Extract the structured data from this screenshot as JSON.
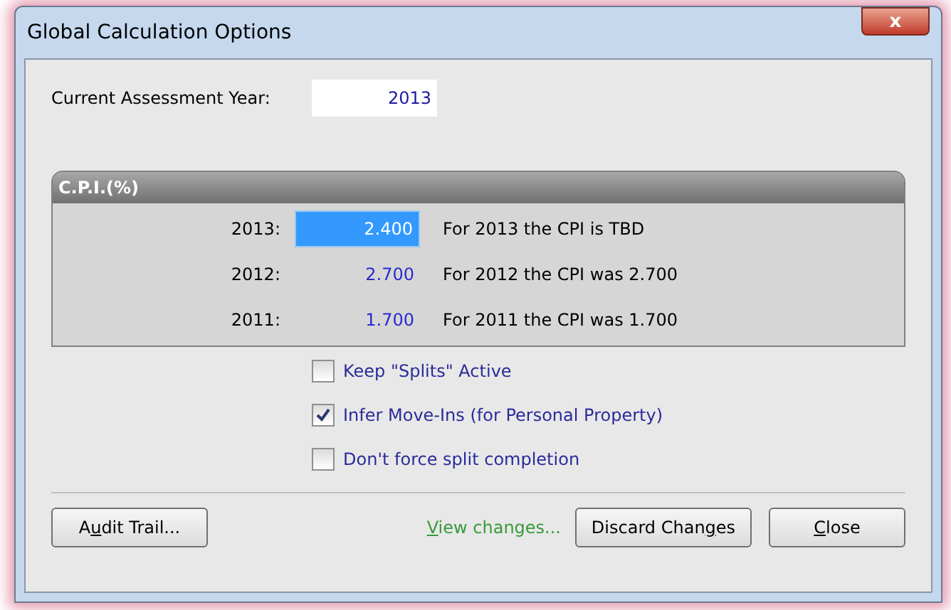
{
  "window": {
    "title": "Global Calculation Options",
    "close_label": "x"
  },
  "assessment_year": {
    "label": "Current Assessment Year:",
    "value": "2013"
  },
  "cpi": {
    "title": "C.P.I.(%)",
    "rows": [
      {
        "year": "2013:",
        "value": "2.400",
        "selected": true,
        "note": "For 2013 the CPI is TBD"
      },
      {
        "year": "2012:",
        "value": "2.700",
        "selected": false,
        "note": "For 2012 the CPI was 2.700"
      },
      {
        "year": "2011:",
        "value": "1.700",
        "selected": false,
        "note": "For 2011 the CPI was 1.700"
      }
    ]
  },
  "options": [
    {
      "label": "Keep \"Splits\" Active",
      "checked": false
    },
    {
      "label": "Infer Move-Ins (for Personal Property)",
      "checked": true
    },
    {
      "label": "Don't force split completion",
      "checked": false
    }
  ],
  "buttons": {
    "audit": {
      "before": "A",
      "access_key": "u",
      "after": "dit Trail..."
    },
    "view_changes": {
      "access_key": "V",
      "after": "iew changes..."
    },
    "discard": {
      "before": "Discard Chan",
      "access_key": "g",
      "after": "es"
    },
    "close": {
      "access_key": "C",
      "after": "lose"
    }
  }
}
